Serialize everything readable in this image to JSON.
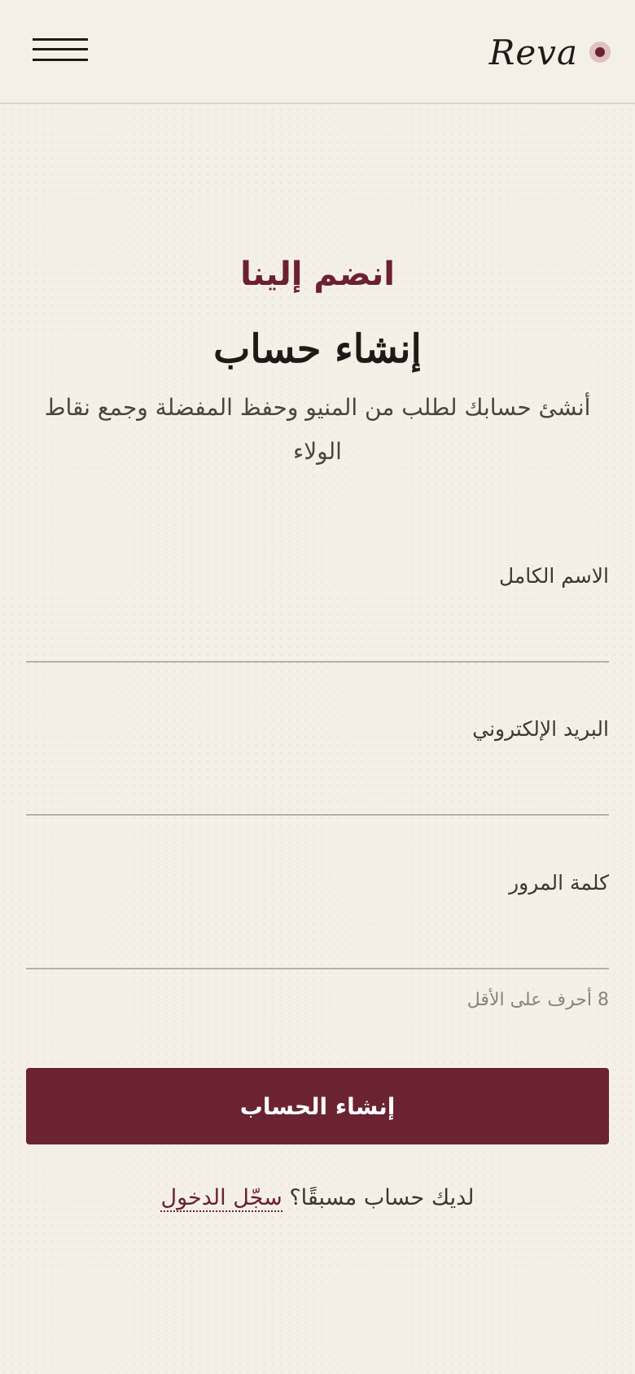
{
  "header": {
    "brand_name": "Reva",
    "brand_accent": "#6b2130",
    "menu_icon": "hamburger-menu-icon"
  },
  "intro": {
    "eyebrow": "انضم إلينا",
    "title": "إنشاء حساب",
    "subtitle": "أنشئ حسابك لطلب من المنيو وحفظ المفضلة وجمع نقاط الولاء"
  },
  "form": {
    "full_name": {
      "label": "الاسم الكامل",
      "value": "",
      "placeholder": ""
    },
    "email": {
      "label": "البريد الإلكتروني",
      "value": "",
      "placeholder": ""
    },
    "password": {
      "label": "كلمة المرور",
      "value": "",
      "placeholder": "",
      "hint": "8 أحرف على الأقل"
    },
    "submit_label": "إنشاء الحساب"
  },
  "footer": {
    "prompt": "لديك حساب مسبقًا؟",
    "login_link": "سجّل الدخول"
  },
  "colors": {
    "background": "#f5f0e7",
    "primary": "#6b2332",
    "text": "#2a2522"
  }
}
